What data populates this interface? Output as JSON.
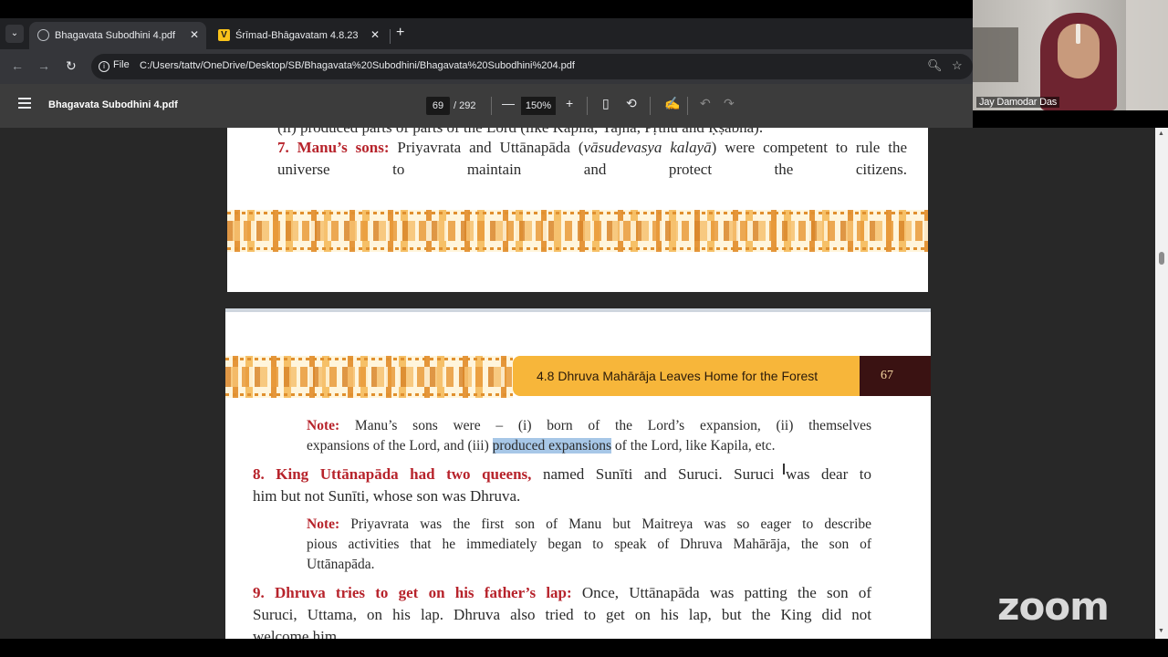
{
  "browser": {
    "tabs": [
      {
        "title": "Bhagavata Subodhini 4.pdf",
        "favicon": "globe-icon",
        "active": true
      },
      {
        "title": "Śrīmad-Bhāgavatam 4.8.23",
        "favicon": "V",
        "active": false
      }
    ],
    "new_tab": "+",
    "omnibox": {
      "chip": "File",
      "url": "C:/Users/tattv/OneDrive/Desktop/SB/Bhagavata%20Subodhini/Bhagavata%20Subodhini%204.pdf"
    }
  },
  "pdf_toolbar": {
    "doc_name": "Bhagavata Subodhini 4.pdf",
    "current_page": "69",
    "total_pages": "/ 292",
    "zoom": "150%"
  },
  "page1": {
    "cut_line": "(ii) produced parts of parts of the Lord (like Kapila, Yajña, Pṛthu and Ṛṣabha).",
    "heading": "7. Manu’s sons:",
    "heading_text_a": " Priyavrata and Uttānapāda (",
    "heading_italic": "vāsudevasya kalayā",
    "heading_text_b": ") were competent to rule the universe to maintain and protect the citizens."
  },
  "page2": {
    "chapter_title": "4.8 Dhruva Mahārāja Leaves Home for the Forest",
    "page_number": "67",
    "note1": {
      "label": "Note:",
      "line1": "Manu’s sons were – (i) born of the Lord’s expansion, (ii) themselves",
      "line2_a": "expansions of the Lord, and (iii)",
      "highlight": "produced expansions",
      "line2_b": "of the Lord, like Kapila, etc."
    },
    "para8": {
      "heading": "8. King Uttānapāda had two queens,",
      "line1": "named Sunīti and Suruci. Suruci was dear to",
      "line2": "him but not Sunīti, whose son was Dhruva."
    },
    "note2": {
      "label": "Note:",
      "line1": "Priyavrata was the first son of Manu but Maitreya was so eager to describe",
      "line2": "pious activities that he immediately began to speak of Dhruva Mahārāja, the son of",
      "line3": "Uttānapāda."
    },
    "para9": {
      "heading": "9. Dhruva tries to get on his father’s lap:",
      "line1": "Once, Uttānapāda was patting the son of",
      "line2": "Suruci, Uttama, on his lap. Dhruva also tried to get on his lap, but the King did not",
      "line3": "welcome him."
    }
  },
  "zoom_meeting": {
    "participant_name": "Jay Damodar Das",
    "logo": "zoom"
  }
}
